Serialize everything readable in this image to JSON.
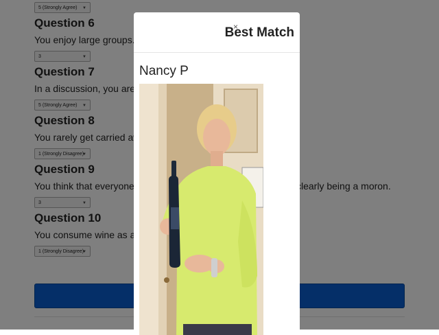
{
  "questions": [
    {
      "title": "",
      "text": "",
      "answer": "5 (Strongly Agree)"
    },
    {
      "title": "Question 6",
      "text": "You enjoy large groups.",
      "answer": "3"
    },
    {
      "title": "Question 7",
      "text": "In a discussion, you are gen",
      "answer": "5 (Strongly Agree)"
    },
    {
      "title": "Question 8",
      "text": "You rarely get carried away",
      "answer": "1 (Strongly Disagree)"
    },
    {
      "title": "Question 9",
      "text": "You think that everyone's vi",
      "text_right": "clearly being a moron.",
      "answer": "3"
    },
    {
      "title": "Question 10",
      "text": "You consume wine as a hob",
      "answer": "1 (Strongly Disagree)"
    }
  ],
  "modal": {
    "close_glyph": "×",
    "title": "Best Match",
    "match_name": "Nancy P"
  },
  "colors": {
    "submit": "#0a5fd1",
    "overlay": "rgba(0,0,0,0.5)"
  }
}
